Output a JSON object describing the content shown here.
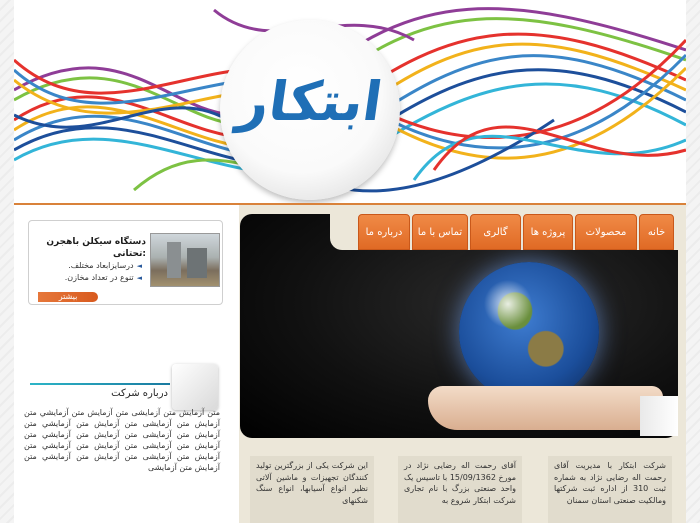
{
  "logo": {
    "text": "ابتکار"
  },
  "nav": {
    "items": [
      {
        "label": "خانه"
      },
      {
        "label": "محصولات"
      },
      {
        "label": "پروژه ها"
      },
      {
        "label": "گالری"
      },
      {
        "label": "تماس با ما"
      },
      {
        "label": "درباره ما"
      }
    ]
  },
  "promo": {
    "title": "دستگاه سیکلن باهجرن تحتانی:",
    "bullets": [
      "درسایزابعاد مختلف.",
      "تنوع در تعداد مخازن."
    ],
    "more_label": "بیشتر"
  },
  "about": {
    "title": "درباره شرکت",
    "text": "متن آزمایش متن آزمایشی متن آزمایش متن آزمایشي متن آزمایش متن آزمایشی متن آزمایش متن آزمایشي متن آزمایش متن آزمایشی متن آزمایش متن آزمایشي متن آزمایش متن آزمایشی متن آزمایش متن آزمایشي متن آزمایش متن آزمایشی متن آزمایش متن آزمایشي متن آزمایش متن آزمایشی"
  },
  "columns": [
    {
      "text": "شرکت ابتکار با مدیریت آقای رحمت اله رضایی نژاد به شماره ثبت 310 از اداره ثبت شرکتها ومالکیت صنعتی استان سمنان"
    },
    {
      "text": "آقای رحمت اله رضایی نژاد در مورخ 15/09/1362 با تاسیس یک واحد صنعتی بزرگ با نام تجاری شرکت ابتکار شروع به"
    },
    {
      "text": "این شرکت یکی از بزرگترین تولید کنندگان تجهیزات و ماشین آلاتی نظیر انواع آسیابها، انواع سنگ شکنهای"
    }
  ],
  "colors": {
    "accent": "#e06a25",
    "logo_blue": "#1f6fb6",
    "content_bg": "#ece7d9"
  }
}
